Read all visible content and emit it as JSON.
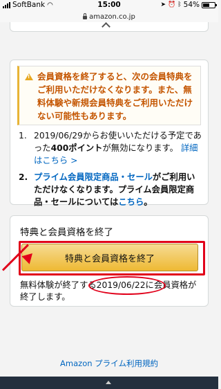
{
  "status": {
    "carrier": "SoftBank",
    "time": "15:00",
    "battery": "54%",
    "battery_level": 0.54
  },
  "url": "amazon.co.jp",
  "warning": {
    "text": "会員資格を終了すると、次の会員特典をご利用いただけなくなります。また、無料体験や新規会員特典をご利用いただけない可能性もあります。"
  },
  "list": [
    {
      "num": "1.",
      "pre": "2019/06/29からお使いいただける予定であった",
      "points": "400ポイント",
      "post": "が無効になります。",
      "link": "詳細はこちら >"
    },
    {
      "num": "2.",
      "link1": "プライム会員限定商品・セール",
      "text": "がご利用いただけなくなります。プライム会員限定商品・セールについては",
      "link2": "こちら",
      "end": "。"
    }
  ],
  "end_section": {
    "title": "特典と会員資格を終了",
    "button": "特典と会員資格を終了",
    "note": "無料体験が終了する2019/06/22に会員資格が終了します。"
  },
  "footer": {
    "terms_link": "Amazon プライム利用規約"
  },
  "colors": {
    "accent": "#e1001a",
    "link": "#0066c0",
    "warning": "#c45500",
    "button": "#f0c14b"
  }
}
